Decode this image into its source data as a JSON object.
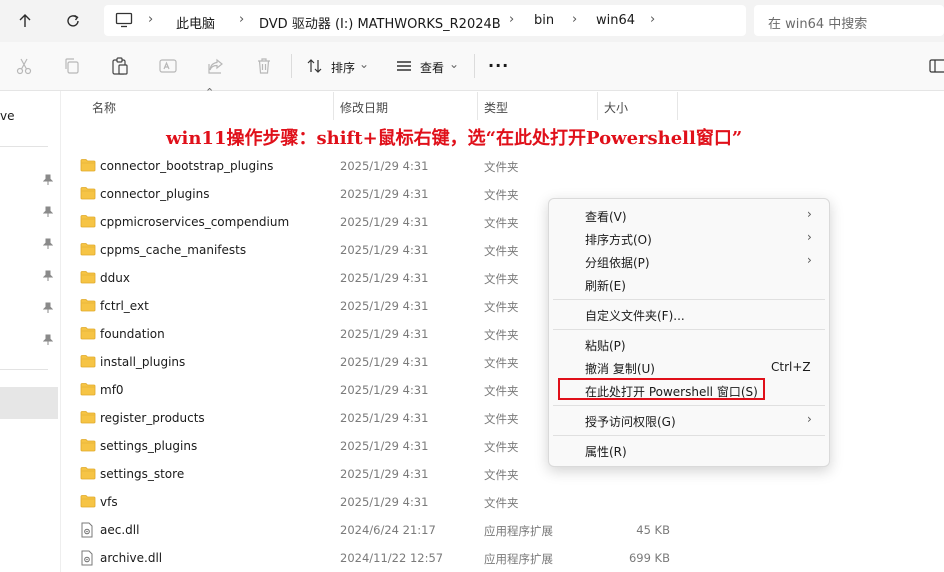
{
  "address": {
    "breadcrumbs": [
      "此电脑",
      "DVD 驱动器 (I:) MATHWORKS_R2024B",
      "bin",
      "win64"
    ],
    "search_placeholder": "在 win64 中搜索"
  },
  "toolbar": {
    "sort_label": "排序",
    "view_label": "查看",
    "more_label": "···"
  },
  "leftnav": {
    "partial_label": "ve"
  },
  "columns": {
    "name": "名称",
    "date": "修改日期",
    "type": "类型",
    "size": "大小"
  },
  "annotation": "win11操作步骤：shift+鼠标右键，选“在此处打开Powershell窗口”",
  "files": [
    {
      "name": "connector_bootstrap_plugins",
      "date": "2025/1/29 4:31",
      "type": "文件夹",
      "size": "",
      "kind": "folder"
    },
    {
      "name": "connector_plugins",
      "date": "2025/1/29 4:31",
      "type": "文件夹",
      "size": "",
      "kind": "folder"
    },
    {
      "name": "cppmicroservices_compendium",
      "date": "2025/1/29 4:31",
      "type": "文件夹",
      "size": "",
      "kind": "folder"
    },
    {
      "name": "cppms_cache_manifests",
      "date": "2025/1/29 4:31",
      "type": "文件夹",
      "size": "",
      "kind": "folder"
    },
    {
      "name": "ddux",
      "date": "2025/1/29 4:31",
      "type": "文件夹",
      "size": "",
      "kind": "folder"
    },
    {
      "name": "fctrl_ext",
      "date": "2025/1/29 4:31",
      "type": "文件夹",
      "size": "",
      "kind": "folder"
    },
    {
      "name": "foundation",
      "date": "2025/1/29 4:31",
      "type": "文件夹",
      "size": "",
      "kind": "folder"
    },
    {
      "name": "install_plugins",
      "date": "2025/1/29 4:31",
      "type": "文件夹",
      "size": "",
      "kind": "folder"
    },
    {
      "name": "mf0",
      "date": "2025/1/29 4:31",
      "type": "文件夹",
      "size": "",
      "kind": "folder"
    },
    {
      "name": "register_products",
      "date": "2025/1/29 4:31",
      "type": "文件夹",
      "size": "",
      "kind": "folder"
    },
    {
      "name": "settings_plugins",
      "date": "2025/1/29 4:31",
      "type": "文件夹",
      "size": "",
      "kind": "folder"
    },
    {
      "name": "settings_store",
      "date": "2025/1/29 4:31",
      "type": "文件夹",
      "size": "",
      "kind": "folder"
    },
    {
      "name": "vfs",
      "date": "2025/1/29 4:31",
      "type": "文件夹",
      "size": "",
      "kind": "folder"
    },
    {
      "name": "aec.dll",
      "date": "2024/6/24 21:17",
      "type": "应用程序扩展",
      "size": "45 KB",
      "kind": "dll"
    },
    {
      "name": "archive.dll",
      "date": "2024/11/22 12:57",
      "type": "应用程序扩展",
      "size": "699 KB",
      "kind": "dll"
    }
  ],
  "context_menu": {
    "view": "查看(V)",
    "sort_by": "排序方式(O)",
    "group_by": "分组依据(P)",
    "refresh": "刷新(E)",
    "customize": "自定义文件夹(F)...",
    "paste": "粘贴(P)",
    "undo_copy": "撤消 复制(U)",
    "undo_shortcut": "Ctrl+Z",
    "open_powershell": "在此处打开 Powershell 窗口(S)",
    "grant_access": "授予访问权限(G)",
    "properties": "属性(R)"
  },
  "colors": {
    "annotation_red": "#e0101a",
    "folder_yellow": "#f6c445"
  }
}
